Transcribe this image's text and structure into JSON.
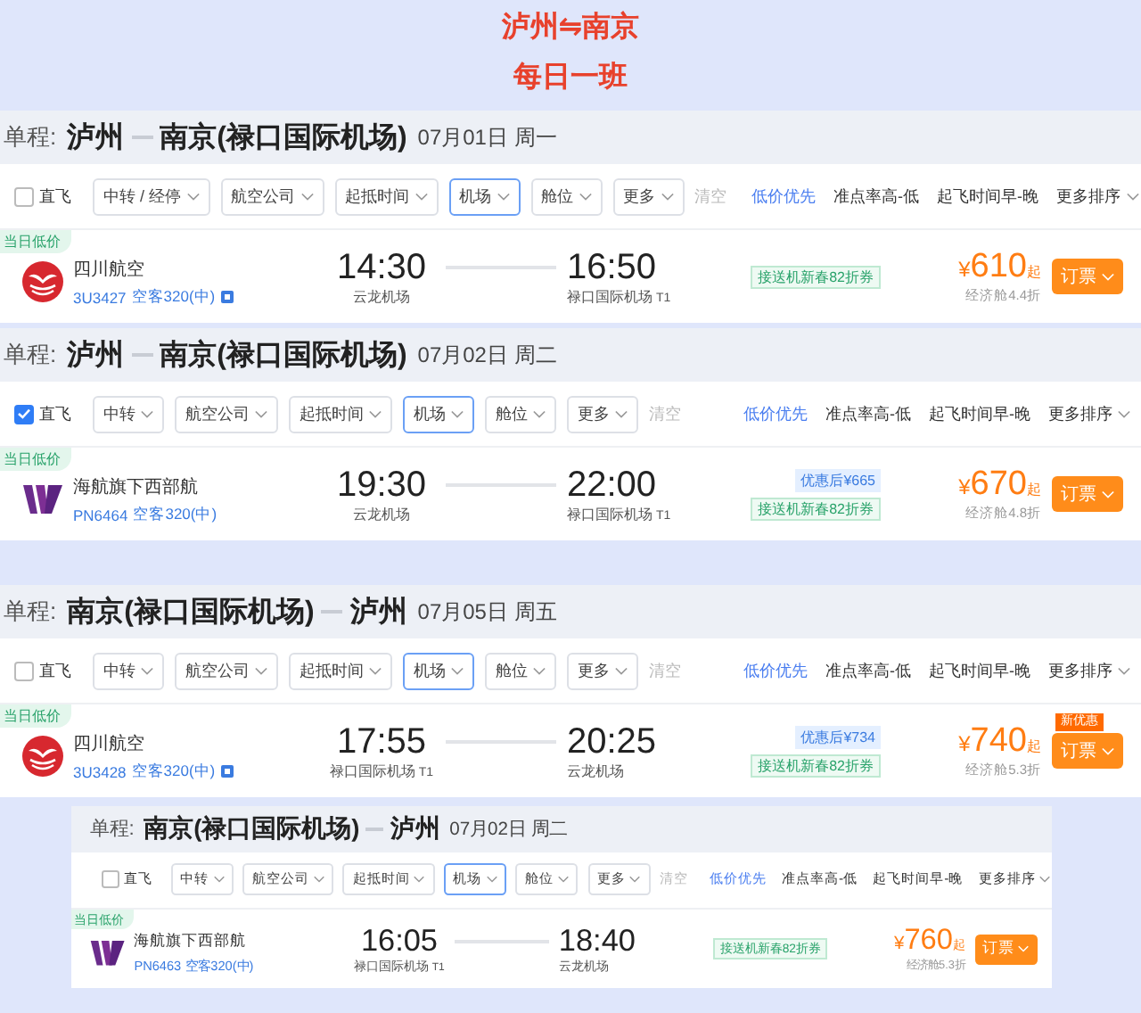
{
  "title": {
    "route": "泸州⇋南京",
    "frequency": "每日一班"
  },
  "sections": [
    {
      "kind": "full",
      "trip_label": "单程:",
      "from": "泸州",
      "to": "南京(禄口国际机场)",
      "date": "07月01日 周一",
      "direct": {
        "label": "直飞",
        "checked": false
      },
      "filters": [
        {
          "label": "中转 / 经停",
          "selected": false
        },
        {
          "label": "航空公司",
          "selected": false
        },
        {
          "label": "起抵时间",
          "selected": false
        },
        {
          "label": "机场",
          "selected": true
        },
        {
          "label": "舱位",
          "selected": false
        },
        {
          "label": "更多",
          "selected": false
        }
      ],
      "clear": "清空",
      "sorts": [
        {
          "label": "低价优先",
          "kind": "plain",
          "selected": true
        },
        {
          "label": "准点率高-低",
          "kind": "plain",
          "selected": false
        },
        {
          "label": "起飞时间早-晚",
          "kind": "plain",
          "selected": false
        },
        {
          "label": "更多排序",
          "kind": "menu",
          "selected": false
        }
      ],
      "flight": {
        "kind": "red-circle",
        "tag": "当日低价",
        "airline": "四川航空",
        "flight_no": "3U3427",
        "aircraft": "空客320(中)",
        "info_icon": true,
        "depart": {
          "time": "14:30",
          "airport": "云龙机场"
        },
        "arrive": {
          "time": "16:50",
          "airport": "禄口国际机场",
          "terminal": "T1"
        },
        "coupon": "接送机新春82折券",
        "currency": "¥",
        "price": "610",
        "price_suffix": "起",
        "cabin": "经济舱4.4折",
        "button": "订票"
      }
    },
    {
      "kind": "full",
      "trip_label": "单程:",
      "from": "泸州",
      "to": "南京(禄口国际机场)",
      "date": "07月02日 周二",
      "direct": {
        "label": "直飞",
        "checked": true
      },
      "filters": [
        {
          "label": "中转",
          "selected": false
        },
        {
          "label": "航空公司",
          "selected": false
        },
        {
          "label": "起抵时间",
          "selected": false
        },
        {
          "label": "机场",
          "selected": true
        },
        {
          "label": "舱位",
          "selected": false
        },
        {
          "label": "更多",
          "selected": false
        }
      ],
      "clear": "清空",
      "sorts": [
        {
          "label": "低价优先",
          "kind": "plain",
          "selected": true
        },
        {
          "label": "准点率高-低",
          "kind": "plain",
          "selected": false
        },
        {
          "label": "起飞时间早-晚",
          "kind": "plain",
          "selected": false
        },
        {
          "label": "更多排序",
          "kind": "menu",
          "selected": false
        }
      ],
      "flight": {
        "kind": "purple-w",
        "tag": "当日低价",
        "airline": "海航旗下西部航",
        "flight_no": "PN6464",
        "aircraft": "空客320(中)",
        "info_icon": false,
        "depart": {
          "time": "19:30",
          "airport": "云龙机场"
        },
        "arrive": {
          "time": "22:00",
          "airport": "禄口国际机场",
          "terminal": "T1"
        },
        "promo": "优惠后¥665",
        "coupon": "接送机新春82折券",
        "currency": "¥",
        "price": "670",
        "price_suffix": "起",
        "cabin": "经济舱4.8折",
        "button": "订票"
      }
    },
    {
      "kind": "full",
      "trip_label": "单程:",
      "from": "南京(禄口国际机场)",
      "to": "泸州",
      "date": "07月05日 周五",
      "direct": {
        "label": "直飞",
        "checked": false
      },
      "filters": [
        {
          "label": "中转",
          "selected": false
        },
        {
          "label": "航空公司",
          "selected": false
        },
        {
          "label": "起抵时间",
          "selected": false
        },
        {
          "label": "机场",
          "selected": true
        },
        {
          "label": "舱位",
          "selected": false
        },
        {
          "label": "更多",
          "selected": false
        }
      ],
      "clear": "清空",
      "sorts": [
        {
          "label": "低价优先",
          "kind": "plain",
          "selected": true
        },
        {
          "label": "准点率高-低",
          "kind": "plain",
          "selected": false
        },
        {
          "label": "起飞时间早-晚",
          "kind": "plain",
          "selected": false
        },
        {
          "label": "更多排序",
          "kind": "menu",
          "selected": false
        }
      ],
      "flight": {
        "kind": "red-circle",
        "tag": "当日低价",
        "airline": "四川航空",
        "flight_no": "3U3428",
        "aircraft": "空客320(中)",
        "info_icon": true,
        "depart": {
          "time": "17:55",
          "airport": "禄口国际机场",
          "terminal": "T1"
        },
        "arrive": {
          "time": "20:25",
          "airport": "云龙机场"
        },
        "promo": "优惠后¥734",
        "coupon": "接送机新春82折券",
        "currency": "¥",
        "price": "740",
        "price_suffix": "起",
        "cabin": "经济舱5.3折",
        "button": "订票",
        "badge": "新优惠"
      }
    },
    {
      "kind": "inset",
      "trip_label": "单程:",
      "from": "南京(禄口国际机场)",
      "to": "泸州",
      "date": "07月02日 周二",
      "direct": {
        "label": "直飞",
        "checked": false
      },
      "filters": [
        {
          "label": "中转",
          "selected": false
        },
        {
          "label": "航空公司",
          "selected": false
        },
        {
          "label": "起抵时间",
          "selected": false
        },
        {
          "label": "机场",
          "selected": true
        },
        {
          "label": "舱位",
          "selected": false
        },
        {
          "label": "更多",
          "selected": false
        }
      ],
      "clear": "清空",
      "sorts": [
        {
          "label": "低价优先",
          "kind": "plain",
          "selected": true
        },
        {
          "label": "准点率高-低",
          "kind": "plain",
          "selected": false
        },
        {
          "label": "起飞时间早-晚",
          "kind": "plain",
          "selected": false
        },
        {
          "label": "更多排序",
          "kind": "menu",
          "selected": false
        }
      ],
      "flight": {
        "kind": "purple-w",
        "tag": "当日低价",
        "airline": "海航旗下西部航",
        "flight_no": "PN6463",
        "aircraft": "空客320(中)",
        "info_icon": false,
        "depart": {
          "time": "16:05",
          "airport": "禄口国际机场",
          "terminal": "T1"
        },
        "arrive": {
          "time": "18:40",
          "airport": "云龙机场"
        },
        "coupon": "接送机新春82折券",
        "currency": "¥",
        "price": "760",
        "price_suffix": "起",
        "cabin": "经济舱5.3折",
        "button": "订票"
      }
    }
  ]
}
